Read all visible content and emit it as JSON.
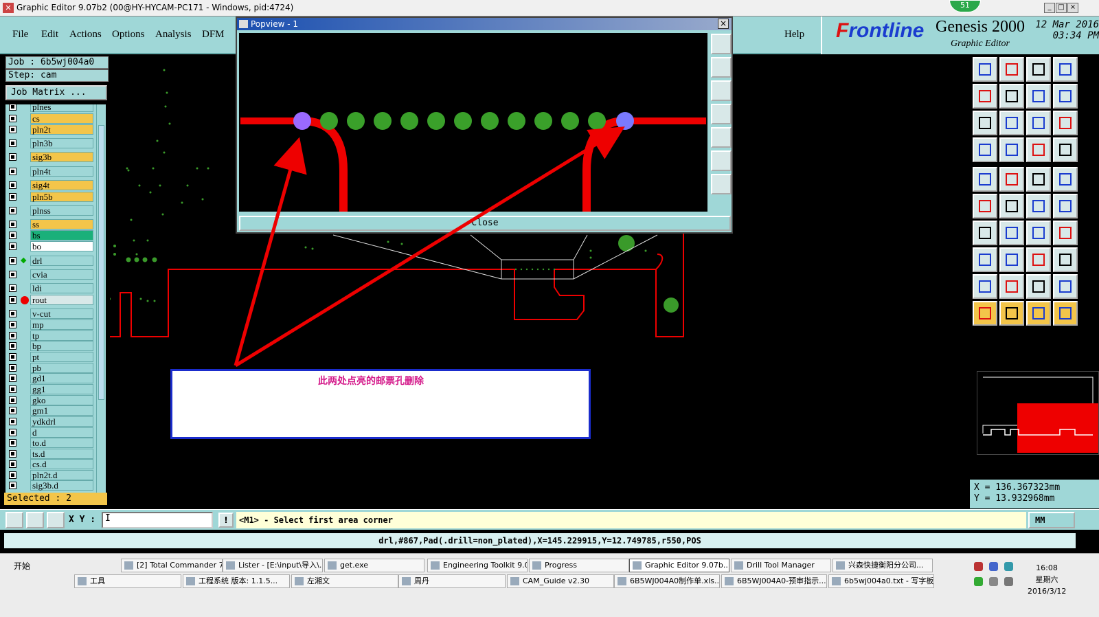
{
  "window": {
    "title": "Graphic Editor 9.07b2 (00@HY-HYCAM-PC171 - Windows, pid:4724)",
    "badge": "51"
  },
  "menu": [
    "File",
    "Edit",
    "Actions",
    "Options",
    "Analysis",
    "DFM"
  ],
  "help_label": "Help",
  "logo": {
    "brand_prefix": "F",
    "brand_rest": "rontline",
    "product": "Genesis 2000",
    "subtitle": "Graphic Editor",
    "date_line1": "12 Mar 2016",
    "date_line2": "03:34 PM"
  },
  "job": {
    "job_line": "Job : 6b5wj004a0",
    "step_line": "Step: cam",
    "matrix_button": "Job Matrix ..."
  },
  "layers": [
    {
      "name": "plnes",
      "color": "#9fd7d7"
    },
    {
      "name": "cs",
      "color": "#f3c54a"
    },
    {
      "name": "pln2t",
      "color": "#f3c54a"
    },
    {
      "name": "pln3b",
      "color": "#9fd7d7"
    },
    {
      "name": "sig3b",
      "color": "#f3c54a"
    },
    {
      "name": "pln4t",
      "color": "#9fd7d7"
    },
    {
      "name": "sig4t",
      "color": "#f3c54a"
    },
    {
      "name": "pln5b",
      "color": "#f3c54a"
    },
    {
      "name": "plnss",
      "color": "#9fd7d7"
    },
    {
      "name": "ss",
      "color": "#f3c54a"
    },
    {
      "name": "bs",
      "color": "#1ab07a"
    },
    {
      "name": "bo",
      "color": "#ffffff"
    },
    {
      "name": "drl",
      "color": "#9fd7d7",
      "marker": "tri"
    },
    {
      "name": "cvia",
      "color": "#9fd7d7"
    },
    {
      "name": "ldi",
      "color": "#9fd7d7"
    },
    {
      "name": "rout",
      "color": "#d8e8e8",
      "marker": "dot"
    },
    {
      "name": "v-cut",
      "color": "#9fd7d7"
    },
    {
      "name": "mp",
      "color": "#9fd7d7"
    },
    {
      "name": "tp",
      "color": "#9fd7d7"
    },
    {
      "name": "bp",
      "color": "#9fd7d7"
    },
    {
      "name": "pt",
      "color": "#9fd7d7"
    },
    {
      "name": "pb",
      "color": "#9fd7d7"
    },
    {
      "name": "gd1",
      "color": "#9fd7d7"
    },
    {
      "name": "gg1",
      "color": "#9fd7d7"
    },
    {
      "name": "gko",
      "color": "#9fd7d7"
    },
    {
      "name": "gm1",
      "color": "#9fd7d7"
    },
    {
      "name": "ydkdrl",
      "color": "#9fd7d7"
    },
    {
      "name": "d",
      "color": "#9fd7d7"
    },
    {
      "name": "to.d",
      "color": "#9fd7d7"
    },
    {
      "name": "ts.d",
      "color": "#9fd7d7"
    },
    {
      "name": "cs.d",
      "color": "#9fd7d7"
    },
    {
      "name": "pln2t.d",
      "color": "#9fd7d7"
    },
    {
      "name": "sig3b.d",
      "color": "#9fd7d7"
    }
  ],
  "selected_label": "Selected : 2",
  "popview": {
    "title": "Popview - 1",
    "close_button": "Close",
    "close_x": "×"
  },
  "annotation": "此两处点亮的邮票孔删除",
  "coords": {
    "x_line": "X = 136.367323mm",
    "y_line": "Y = 13.932968mm"
  },
  "command": {
    "xy_label": "X Y :",
    "xy_value": "I",
    "bang": "!",
    "prompt": "<M1> - Select first area corner",
    "unit": "MM"
  },
  "status_info": "drl,#867,Pad(.drill=non_plated),X=145.229915,Y=12.749785,r550,POS",
  "taskbar": {
    "start": "开始",
    "row1": [
      "[2] Total Commander 7...",
      "Lister - [E:\\input\\导入\\...",
      "get.exe",
      "Engineering Toolkit 9.0...",
      "Progress",
      "Graphic Editor 9.07b...",
      "Drill Tool Manager",
      "兴森快捷衡阳分公司..."
    ],
    "row2": [
      "工具",
      "工程系统  版本: 1.1.5...",
      "左湘文",
      "周丹",
      "CAM_Guide v2.30",
      "6B5WJ004A0制作单.xls...",
      "6B5WJ004A0-预审指示...",
      "6b5wj004a0.txt - 写字板"
    ],
    "clock_time": "16:08",
    "clock_day": "星期六",
    "clock_date": "2016/3/12"
  }
}
